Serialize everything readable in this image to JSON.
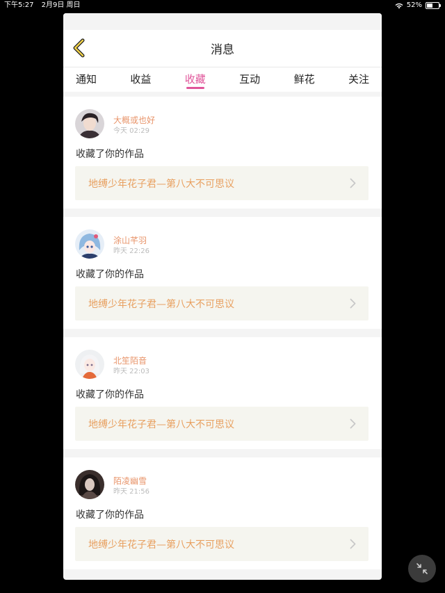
{
  "status_bar": {
    "time": "下午5:27",
    "date": "2月9日 周日",
    "battery_percent": "52%",
    "battery_level": 0.52
  },
  "header": {
    "title": "消息"
  },
  "tabs": [
    {
      "label": "通知",
      "active": false
    },
    {
      "label": "收益",
      "active": false
    },
    {
      "label": "收藏",
      "active": true
    },
    {
      "label": "互动",
      "active": false
    },
    {
      "label": "鲜花",
      "active": false
    },
    {
      "label": "关注",
      "active": false
    }
  ],
  "colors": {
    "accent": "#e0559a",
    "username": "#e8946a",
    "work_title": "#e8a060"
  },
  "items": [
    {
      "username": "大概或也好",
      "time": "今天 02:29",
      "action": "收藏了你的作品",
      "work_title": "地缚少年花子君—第八大不可思议"
    },
    {
      "username": "涂山芊羽",
      "time": "昨天 22:26",
      "action": "收藏了你的作品",
      "work_title": "地缚少年花子君—第八大不可思议"
    },
    {
      "username": "北笙陌音",
      "time": "昨天 22:03",
      "action": "收藏了你的作品",
      "work_title": "地缚少年花子君—第八大不可思议"
    },
    {
      "username": "陌凌幽雪",
      "time": "昨天 21:56",
      "action": "收藏了你的作品",
      "work_title": "地缚少年花子君—第八大不可思议"
    }
  ]
}
